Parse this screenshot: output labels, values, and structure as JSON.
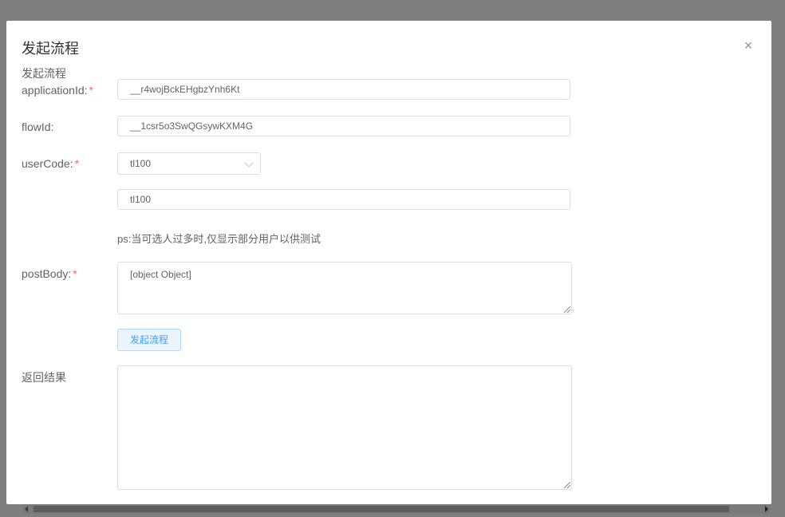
{
  "dialog": {
    "title": "发起流程",
    "close_glyph": "×",
    "section_label": "发起流程"
  },
  "form": {
    "application_id": {
      "label": "applicationId:",
      "required": true,
      "value": "__r4wojBckEHgbzYnh6Kt"
    },
    "flow_id": {
      "label": "flowId:",
      "required": false,
      "value": "__1csr5o3SwQGsywKXM4G"
    },
    "user_code": {
      "label": "userCode:",
      "required": true,
      "select_value": "tl100",
      "input_value": "tl100"
    },
    "hint": "ps:当可选人过多时,仅显示部分用户以供测试",
    "post_body": {
      "label": "postBody:",
      "required": true,
      "value": "[object Object]"
    },
    "submit_label": "发起流程",
    "result": {
      "label": "返回结果",
      "value": ""
    }
  },
  "required_mark": "*",
  "colors": {
    "required": "#f56c6c",
    "primary": "#409eff",
    "button_bg": "#ecf5ff",
    "overlay": "#7f7f7f"
  }
}
